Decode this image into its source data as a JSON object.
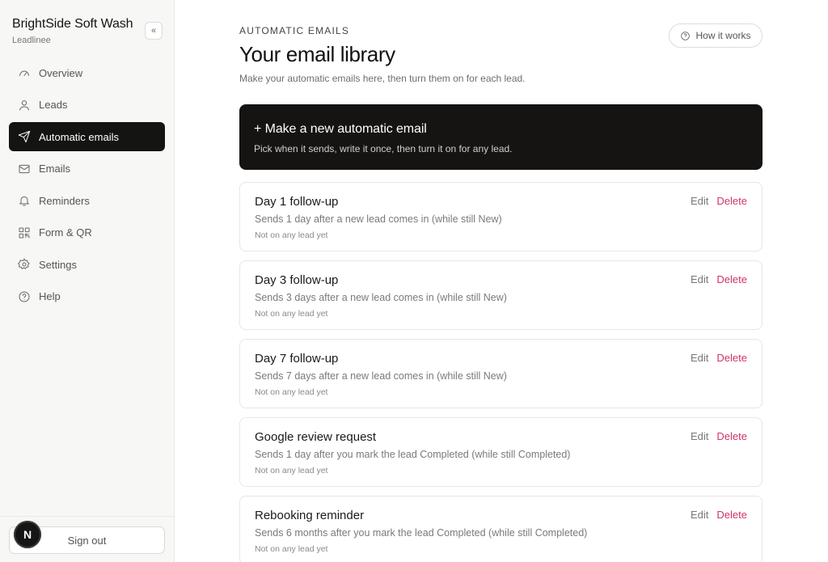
{
  "sidebar": {
    "brand_name": "BrightSide Soft Wash",
    "brand_sub": "Leadlinee",
    "collapse_label": "«",
    "items": [
      {
        "label": "Overview",
        "icon": "gauge-icon"
      },
      {
        "label": "Leads",
        "icon": "user-icon"
      },
      {
        "label": "Automatic emails",
        "icon": "send-icon",
        "active": true
      },
      {
        "label": "Emails",
        "icon": "mail-icon"
      },
      {
        "label": "Reminders",
        "icon": "bell-icon"
      },
      {
        "label": "Form & QR",
        "icon": "qr-icon"
      },
      {
        "label": "Settings",
        "icon": "gear-icon"
      },
      {
        "label": "Help",
        "icon": "help-icon"
      }
    ],
    "signout_label": "Sign out",
    "avatar_letter": "N"
  },
  "header": {
    "eyebrow": "AUTOMATIC EMAILS",
    "title": "Your email library",
    "subtitle": "Make your automatic emails here, then turn them on for each lead.",
    "how_label": "How it works"
  },
  "new_card": {
    "title": "+ Make a new automatic email",
    "subtitle": "Pick when it sends, write it once, then turn it on for any lead."
  },
  "emails": [
    {
      "title": "Day 1 follow-up",
      "desc": "Sends 1 day after a new lead comes in (while still New)",
      "status": "Not on any lead yet",
      "edit": "Edit",
      "delete": "Delete"
    },
    {
      "title": "Day 3 follow-up",
      "desc": "Sends 3 days after a new lead comes in (while still New)",
      "status": "Not on any lead yet",
      "edit": "Edit",
      "delete": "Delete"
    },
    {
      "title": "Day 7 follow-up",
      "desc": "Sends 7 days after a new lead comes in (while still New)",
      "status": "Not on any lead yet",
      "edit": "Edit",
      "delete": "Delete"
    },
    {
      "title": "Google review request",
      "desc": "Sends 1 day after you mark the lead Completed (while still Completed)",
      "status": "Not on any lead yet",
      "edit": "Edit",
      "delete": "Delete"
    },
    {
      "title": "Rebooking reminder",
      "desc": "Sends 6 months after you mark the lead Completed (while still Completed)",
      "status": "Not on any lead yet",
      "edit": "Edit",
      "delete": "Delete"
    }
  ],
  "colors": {
    "accent_dark": "#161412",
    "delete": "#d1326b",
    "sidebar_bg": "#f7f7f6"
  }
}
